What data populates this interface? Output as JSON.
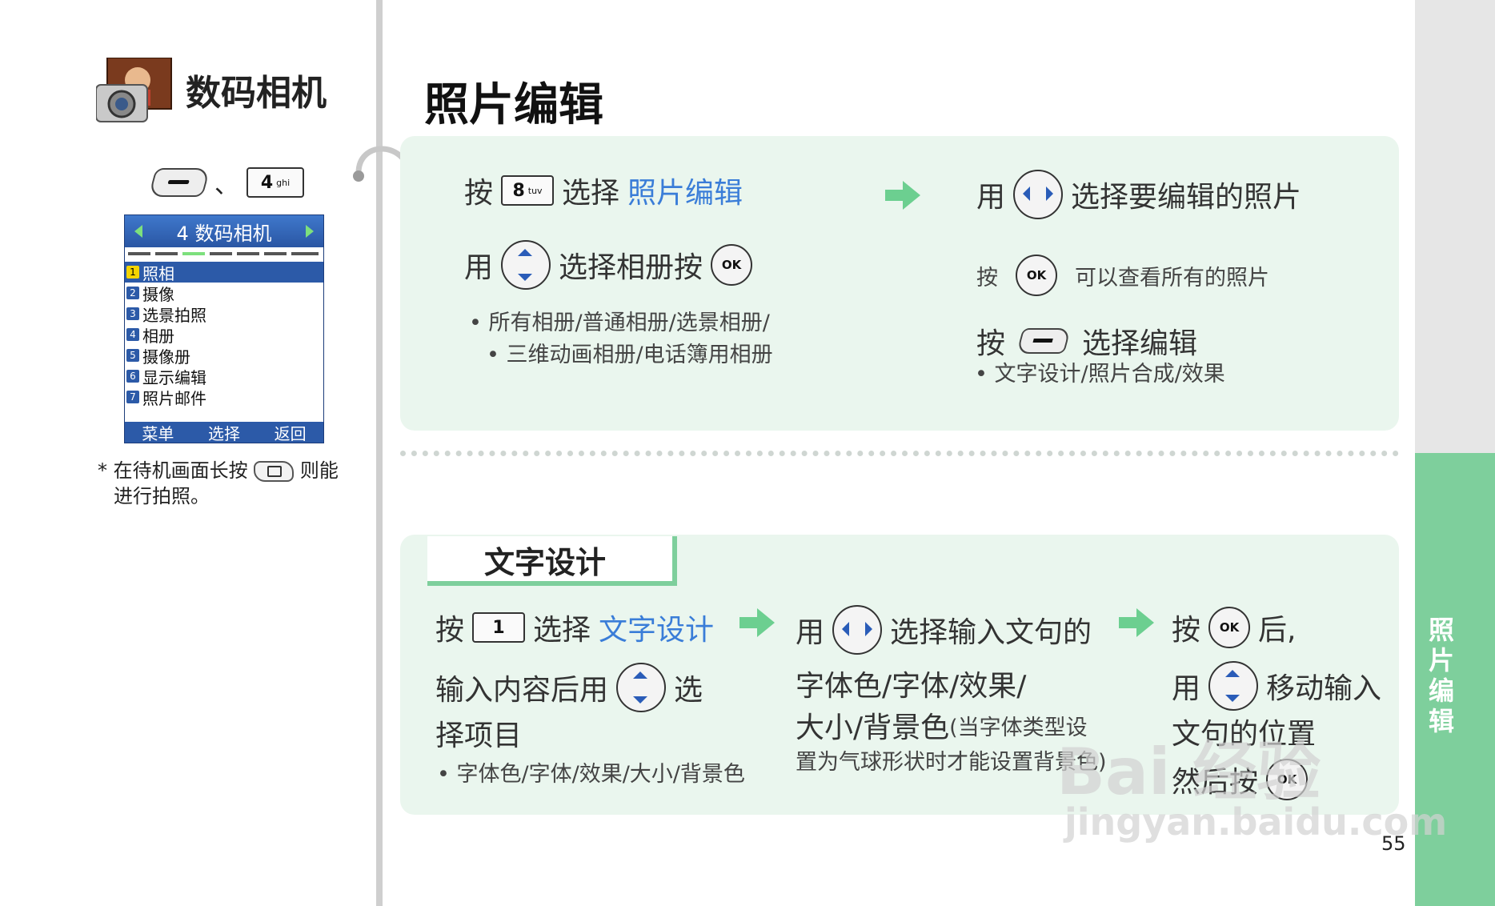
{
  "sidebar": {
    "section_title": "数码相机",
    "key_separator": "、",
    "key_num_label": "4",
    "key_num_sub": "ghi",
    "phone": {
      "header": "4 数码相机",
      "items": [
        {
          "num": "1",
          "label": "照相"
        },
        {
          "num": "2",
          "label": "摄像"
        },
        {
          "num": "3",
          "label": "选景拍照"
        },
        {
          "num": "4",
          "label": "相册"
        },
        {
          "num": "5",
          "label": "摄像册"
        },
        {
          "num": "6",
          "label": "显示编辑"
        },
        {
          "num": "7",
          "label": "照片邮件"
        }
      ],
      "softkeys": [
        "菜单",
        "选择",
        "返回"
      ]
    },
    "note_prefix": "* 在待机画面长按",
    "note_suffix": "则能",
    "note_line2": "进行拍照。"
  },
  "main": {
    "title": "照片编辑",
    "step1": {
      "press": "按",
      "key": "8",
      "key_sub": "tuv",
      "select": "选择",
      "link": "照片编辑"
    },
    "step2": {
      "use": "用",
      "text": "选择相册按",
      "ok": "OK"
    },
    "bullet1_line1": "所有相册/普通相册/选景相册/",
    "bullet1_line2": "三维动画相册/电话簿用相册",
    "step3": {
      "use": "用",
      "text": "选择要编辑的照片"
    },
    "step4": {
      "press": "按",
      "text": "可以查看所有的照片",
      "ok": "OK"
    },
    "step5": {
      "press": "按",
      "text": "选择编辑"
    },
    "bullet2": "文字设计/照片合成/效果"
  },
  "text_design": {
    "tab_title": "文字设计",
    "col1": {
      "press": "按",
      "key": "1",
      "select": "选择",
      "link": "文字设计",
      "line2a": "输入内容后用",
      "line2b": "选",
      "line3": "择项目",
      "bullet": "字体色/字体/效果/大小/背景色"
    },
    "col2": {
      "use": "用",
      "text": "选择输入文句的",
      "line2": "字体色/字体/效果/",
      "line3": "大小/背景色",
      "note1": "(当字体类型设",
      "note2": "置为气球形状时才能设置背景色)"
    },
    "col3": {
      "press": "按",
      "after": "后,",
      "use": "用",
      "move": "移动输入",
      "line3": "文句的位置",
      "then": "然后按",
      "ok": "OK"
    }
  },
  "right_tab_label": "照片编辑",
  "page_number": "55",
  "watermark": "Bai 经验",
  "watermark_url": "jingyan.baidu.com",
  "colors": {
    "accent_green": "#7ecf9c",
    "panel_bg": "#eaf6ee",
    "link_blue": "#3a7dd8",
    "phone_blue": "#2c5aa8"
  }
}
